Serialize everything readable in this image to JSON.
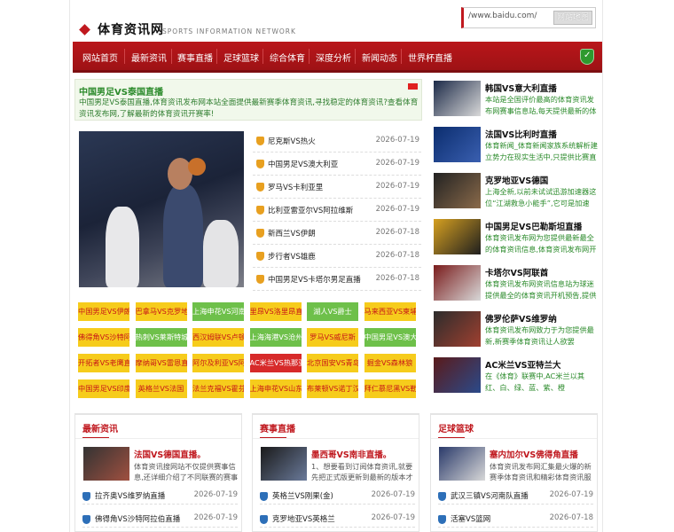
{
  "header": {
    "site_title": "体育资讯网",
    "site_subtitle": "SPORTS INFORMATION NETWORK",
    "search_value": "/www.baidu.com/",
    "search_button": "网站地图"
  },
  "nav": {
    "items": [
      "网站首页",
      "最新资讯",
      "赛事直播",
      "足球篮球",
      "综合体育",
      "深度分析",
      "新闻动态",
      "世界杯直播"
    ]
  },
  "intro": {
    "title": "中国男足VS泰国直播",
    "desc": "中国男足VS泰国直播,体育资讯发布网本站全面提供最新赛季体育资讯,寻找稳定的体育资讯?查看体育资讯发布网,了解最新的体育资讯开赛率!"
  },
  "news": [
    {
      "title": "尼克斯VS热火",
      "date": "2026-07-19"
    },
    {
      "title": "中国男足VS澳大利亚",
      "date": "2026-07-19"
    },
    {
      "title": "罗马VS卡利亚里",
      "date": "2026-07-19"
    },
    {
      "title": "比利亚雷亚尔VS阿拉维斯",
      "date": "2026-07-19"
    },
    {
      "title": "新西兰VS伊朗",
      "date": "2026-07-18"
    },
    {
      "title": "步行者VS雄鹿",
      "date": "2026-07-18"
    },
    {
      "title": "中国男足VS卡塔尔男足直播",
      "date": "2026-07-18"
    }
  ],
  "grid": [
    [
      "中国男足VS伊朗",
      "巴拿马VS克罗地",
      "上海申花VS河南",
      "里昂VS洛里昂直",
      "湖人VS爵士",
      "马来西亚VS柬埔"
    ],
    [
      "佛得角VS沙特阿",
      "热刺VS莱斯特城",
      "西汉姆联VS卢顿",
      "上海海港VS沧州",
      "罗马VS威尼斯",
      "中国男足VS澳大"
    ],
    [
      "开拓者VS老鹰直",
      "摩纳哥VS雷恩直",
      "阿尔及利亚VS阿",
      "AC米兰VS热那亚",
      "北京国安VS青岛",
      "掘金VS森林狼"
    ],
    [
      "中国男足VS印度",
      "英格兰VS法国",
      "法兰克福VS霍芬",
      "上海申花VS山东",
      "布莱顿VS诺丁汉",
      "拜仁慕尼黑VS勒"
    ]
  ],
  "grid_colors": {
    "green": "#6ec04a",
    "yellow": "#f6cc1c",
    "red": "#d72a2a"
  },
  "right": [
    {
      "title": "韩国VS意大利直播",
      "desc": "本站是全国评价最高的体育资讯发布网赛事信息站,每天提供最新的体育"
    },
    {
      "title": "法国VS比利时直播",
      "desc": "体育新闻_体育新闻家族系统解析建立势力在现实生活中,只提供比赛直播"
    },
    {
      "title": "克罗地亚VS德国",
      "desc": "上海全新,以前未试试迅游加速器这位“江湖救急小能手”,它可是加速"
    },
    {
      "title": "中国男足VS巴勒斯坦直播",
      "desc": "体育资讯发布网为您提供最新最全的体育资讯信息,体育资讯发布网开赛信"
    },
    {
      "title": "卡塔尔VS阿联酋",
      "desc": "体育资讯发布网资讯信息站为球迷提供最全的体育资讯开机预告,提供球"
    },
    {
      "title": "佛罗伦萨VS维罗纳",
      "desc": "体育资讯发布网致力于为您提供最新,新赛季体育资讯让人欲罢"
    },
    {
      "title": "AC米兰VS亚特兰大",
      "desc": "在《体育》联赛中,AC米兰以其红、白、绿、蓝、紫、橙"
    }
  ],
  "sections": [
    {
      "title": "最新资讯",
      "lead_title": "法国VS德国直播。",
      "lead_desc": "体育资讯搜网站不仅提供赛事信息,还详细介绍了不同联赛的赛事动",
      "rows": [
        {
          "title": "拉齐奥VS维罗纳直播",
          "date": "2026-07-19"
        },
        {
          "title": "佛得角VS沙特阿拉伯直播",
          "date": "2026-07-19"
        }
      ]
    },
    {
      "title": "赛事直播",
      "lead_title": "墨西哥VS南非直播。",
      "lead_desc": "1、想要看到订阅体育资讯,就要先把正式版更新到最新的版本才可",
      "rows": [
        {
          "title": "英格兰VS刚果(金)",
          "date": "2026-07-19"
        },
        {
          "title": "克罗地亚VS英格兰",
          "date": "2026-07-19"
        }
      ]
    },
    {
      "title": "足球篮球",
      "lead_title": "塞内加尔VS佛得角直播",
      "lead_desc": "体育资讯发布网汇集最火爆的新赛季体育资讯和精彩体育资讯服务",
      "rows": [
        {
          "title": "武汉三镇VS河南队直播",
          "date": "2026-07-19"
        },
        {
          "title": "活塞VS篮网",
          "date": "2026-07-18"
        }
      ]
    }
  ]
}
